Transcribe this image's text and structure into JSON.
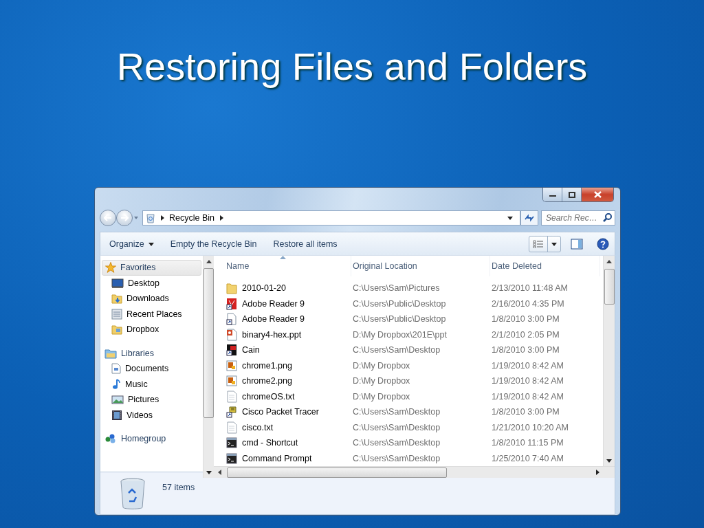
{
  "slide": {
    "title": "Restoring Files and Folders"
  },
  "window": {
    "address": {
      "crumbs": [
        "Recycle Bin"
      ]
    },
    "search": {
      "placeholder": "Search Rec…"
    }
  },
  "toolbar": {
    "buttons": [
      {
        "label": "Organize",
        "kind": "menu"
      },
      {
        "label": "Empty the Recycle Bin",
        "kind": "plain"
      },
      {
        "label": "Restore all items",
        "kind": "plain"
      }
    ]
  },
  "sidebar": {
    "groups": [
      {
        "label": "Favorites",
        "kind": "star",
        "selected": true,
        "children": [
          {
            "label": "Desktop",
            "kind": "desktop",
            "selected": false
          },
          {
            "label": "Downloads",
            "kind": "downloads",
            "selected": false
          },
          {
            "label": "Recent Places",
            "kind": "recent",
            "selected": false
          },
          {
            "label": "Dropbox",
            "kind": "dropbox",
            "selected": false
          }
        ]
      },
      {
        "label": "Libraries",
        "kind": "library",
        "selected": false,
        "children": [
          {
            "label": "Documents",
            "kind": "documents",
            "selected": false
          },
          {
            "label": "Music",
            "kind": "music",
            "selected": false
          },
          {
            "label": "Pictures",
            "kind": "pictures",
            "selected": false
          },
          {
            "label": "Videos",
            "kind": "videos",
            "selected": false
          }
        ]
      },
      {
        "label": "Homegroup",
        "kind": "homegroup",
        "selected": false
      }
    ]
  },
  "table": {
    "columns": [
      {
        "label": "Name",
        "sorted": true
      },
      {
        "label": "Original Location",
        "sorted": false
      },
      {
        "label": "Date Deleted",
        "sorted": false
      }
    ],
    "rows": [
      {
        "kind": "folder",
        "cells": [
          "2010-01-20",
          "C:\\Users\\Sam\\Pictures",
          "2/13/2010 11:48 AM"
        ]
      },
      {
        "kind": "pdf-shortcut",
        "cells": [
          "Adobe Reader 9",
          "C:\\Users\\Public\\Desktop",
          "2/16/2010 4:35 PM"
        ]
      },
      {
        "kind": "doc-shortcut",
        "cells": [
          "Adobe Reader 9",
          "C:\\Users\\Public\\Desktop",
          "1/8/2010 3:00 PM"
        ]
      },
      {
        "kind": "slides",
        "cells": [
          "binary4-hex.ppt",
          "D:\\My Dropbox\\201E\\ppt",
          "2/1/2010 2:05 PM"
        ]
      },
      {
        "kind": "app-shortcut",
        "cells": [
          "Cain",
          "C:\\Users\\Sam\\Desktop",
          "1/8/2010 3:00 PM"
        ]
      },
      {
        "kind": "image",
        "cells": [
          "chrome1.png",
          "D:\\My Dropbox",
          "1/19/2010 8:42 AM"
        ]
      },
      {
        "kind": "image",
        "cells": [
          "chrome2.png",
          "D:\\My Dropbox",
          "1/19/2010 8:42 AM"
        ]
      },
      {
        "kind": "text",
        "cells": [
          "chromeOS.txt",
          "D:\\My Dropbox",
          "1/19/2010 8:42 AM"
        ]
      },
      {
        "kind": "cisco-shortcut",
        "cells": [
          "Cisco Packet Tracer",
          "C:\\Users\\Sam\\Desktop",
          "1/8/2010 3:00 PM"
        ]
      },
      {
        "kind": "text",
        "cells": [
          "cisco.txt",
          "C:\\Users\\Sam\\Desktop",
          "1/21/2010 10:20 AM"
        ]
      },
      {
        "kind": "console",
        "cells": [
          "cmd - Shortcut",
          "C:\\Users\\Sam\\Desktop",
          "1/8/2010 11:15 PM"
        ]
      },
      {
        "kind": "console",
        "cells": [
          "Command Prompt",
          "C:\\Users\\Sam\\Desktop",
          "1/25/2010 7:40 AM"
        ]
      }
    ]
  },
  "status_bar": {
    "count": "57 items"
  }
}
